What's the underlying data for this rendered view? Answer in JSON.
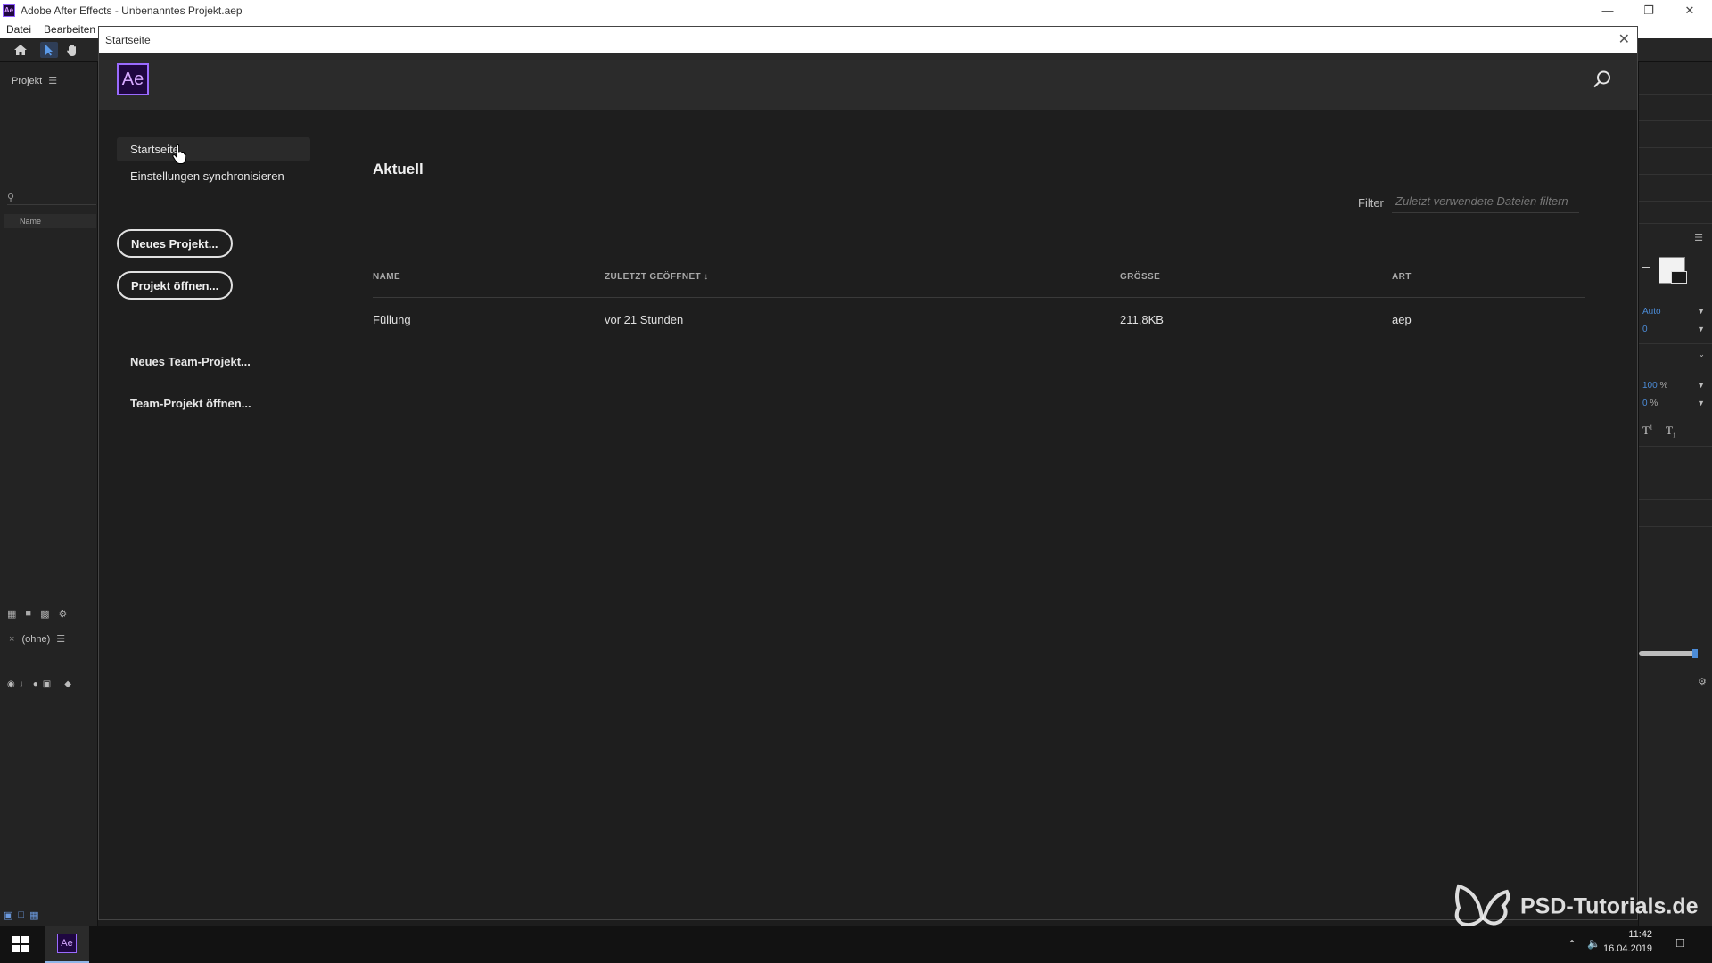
{
  "window": {
    "title": "Adobe After Effects - Unbenanntes Projekt.aep",
    "app_icon": "Ae"
  },
  "menu": [
    "Datei",
    "Bearbeiten"
  ],
  "left_panel": {
    "project_tab": "Projekt",
    "column_name": "Name",
    "timeline_tab": "(ohne)"
  },
  "right_panel": {
    "val_auto": "Auto",
    "val_zero": "0",
    "val_pct100": "100",
    "val_pct0": "0",
    "pct": "%",
    "percent_sign": "%"
  },
  "dialog": {
    "title": "Startseite",
    "logo": "Ae",
    "nav": {
      "home": "Startseite",
      "sync": "Einstellungen synchronisieren"
    },
    "buttons": {
      "new_project": "Neues Projekt...",
      "open_project": "Projekt öffnen..."
    },
    "team": {
      "new": "Neues Team-Projekt...",
      "open": "Team-Projekt öffnen..."
    },
    "recent": {
      "title": "Aktuell",
      "filter_label": "Filter",
      "filter_placeholder": "Zuletzt verwendete Dateien filtern",
      "columns": {
        "name": "NAME",
        "opened": "ZULETZT GEÖFFNET",
        "size": "GRÖSSE",
        "type": "ART"
      },
      "rows": [
        {
          "name": "Füllung",
          "opened": "vor 21 Stunden",
          "size": "211,8KB",
          "type": "aep"
        }
      ]
    }
  },
  "taskbar": {
    "time": "11:42",
    "date": "16.04.2019",
    "ae_label": "Ae"
  },
  "watermark": "PSD-Tutorials.de",
  "colors": {
    "accent": "#9a6bff",
    "ae_bg": "#1f0740",
    "value_blue": "#4c8cd8"
  }
}
